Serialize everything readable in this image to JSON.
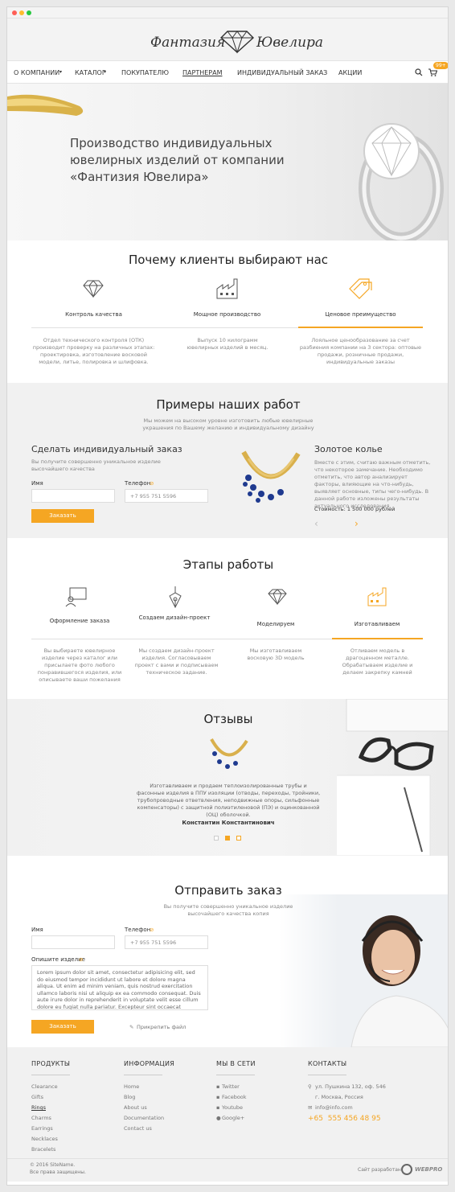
{
  "logo": {
    "part1": "Фантазия",
    "part2": "Ювелира"
  },
  "nav": {
    "items": [
      "О КОМПАНИИ",
      "КАТАЛОГ",
      "ПОКУПАТЕЛЮ",
      "ПАРТНЕРАМ",
      "ИНДИВИДУАЛЬНЫЙ ЗАКАЗ",
      "АКЦИИ"
    ],
    "cart_badge": "99+"
  },
  "hero": {
    "line1": "Производство индивидуальных",
    "line2": "ювелирных изделий от компании",
    "line3": "«Фантизия Ювелира»"
  },
  "why": {
    "title": "Почему клиенты выбирают нас",
    "tabs": [
      {
        "label": "Контроль качества",
        "text": "Отдел технического контроля (ОТК) производит проверку на различных этапах: проектировка, изготовление восковой модели, литье, полировка и шлифовка."
      },
      {
        "label": "Мощное производство",
        "text": "Выпуск 10 килограмм ювелирных изделий в месяц."
      },
      {
        "label": "Ценовое преимущество",
        "text": "Лояльное ценообразование за счет разбиения компании на 3 сектора: оптовые продажи, розничные продажи, индивидуальные заказы"
      }
    ]
  },
  "works": {
    "title": "Примеры наших работ",
    "subtitle": "Мы можем на высоком уровне изготовить любые ювелирные украшения по Вашему желанию и индивидуальному дизайну",
    "order_title": "Сделать индивидуальный заказ",
    "order_sub": "Вы получите совершенно уникальное изделие высочайшего качества",
    "name_label": "Имя",
    "phone_label": "Телефон",
    "phone_placeholder": "+7 955 751 5596",
    "button": "Заказать",
    "item_title": "Золотое колье",
    "item_text": "Вместе с этим, считаю важным отметить, что некоторое замечание. Необходимо отметить, что автор анализирует факторы, влияющие на что-нибудь, выявляет основные, типы чего-нибудь. В данной работе изложены результаты актуального исследования.",
    "price": "Стоимость: 1 500 000 рублей"
  },
  "stages": {
    "title": "Этапы работы",
    "items": [
      {
        "label": "Оформление заказа",
        "text": "Вы выбираете ювелирное изделие через каталог или присылаете фото любого понравившегося изделия, или описываете ваши пожелания"
      },
      {
        "label": "Создаем дизайн-проект",
        "text": "Мы создаем дизайн-проект изделия. Согласовываем проект с вами и подписываем техническое задание."
      },
      {
        "label": "Моделируем",
        "text": "Мы изготавливаем восковую 3D модель"
      },
      {
        "label": "Изготавливаем",
        "text": "Отливаем модель в драгоценном металле. Обрабатываем изделие и делаем закрепку камней"
      }
    ]
  },
  "reviews": {
    "title": "Отзывы",
    "text": "Изготавливаем и продаем теплоизолированные трубы и фасонные изделия в ППУ изоляции (отводы, переходы, тройники, трубопроводные ответвления, неподвижные опоры, сильфонные компенсаторы) с защитной полиэтиленовой (ПЭ) и оцинкованной (ОЦ) оболочкой.",
    "author": "Константин Константинович"
  },
  "send": {
    "title": "Отправить заказ",
    "subtitle": "Вы получите совершенно уникальное изделие высочайшего качества копия",
    "name_label": "Имя",
    "phone_label": "Телефон",
    "phone_placeholder": "+7 955 751 5596",
    "describe_label": "Опишите изделие",
    "describe_text": "Lorem ipsum dolor sit amet, consectetur adipisicing elit, sed do eiusmod tempor incididunt ut labore et dolore magna aliqua. Ut enim ad minim veniam, quis nostrud exercitation ullamco laboris nisi ut aliquip ex ea commodo consequat. Duis aute irure dolor in reprehenderit in voluptate velit esse cillum dolore eu fugiat nulla pariatur. Excepteur sint occaecat cupidatat non",
    "button": "Заказать",
    "attach": "Прикрепить файл"
  },
  "footer": {
    "products": {
      "title": "ПРОДУКТЫ",
      "items": [
        "Clearance",
        "Gifts",
        "Rings",
        "Charms",
        "Earrings",
        "Necklaces",
        "Bracelets"
      ]
    },
    "info": {
      "title": "ИНФОРМАЦИЯ",
      "items": [
        "Home",
        "Blog",
        "About us",
        "Documentation",
        "Contact us"
      ]
    },
    "social": {
      "title": "МЫ В СЕТИ",
      "items": [
        "Twitter",
        "Facebook",
        "Youtube",
        "Google+"
      ]
    },
    "contacts": {
      "title": "КОНТАКТЫ",
      "address1": "ул. Пушкина 132, оф. 546",
      "address2": "г. Москва, Россия",
      "email": "info@info.com",
      "phone": "+65  555 456 48 95"
    },
    "copyright1": "© 2016 SiteName.",
    "copyright2": "Все права защищены.",
    "dev_label": "Сайт разработан",
    "dev_brand": "WEBPRO"
  },
  "colors": {
    "accent": "#f5a623"
  }
}
